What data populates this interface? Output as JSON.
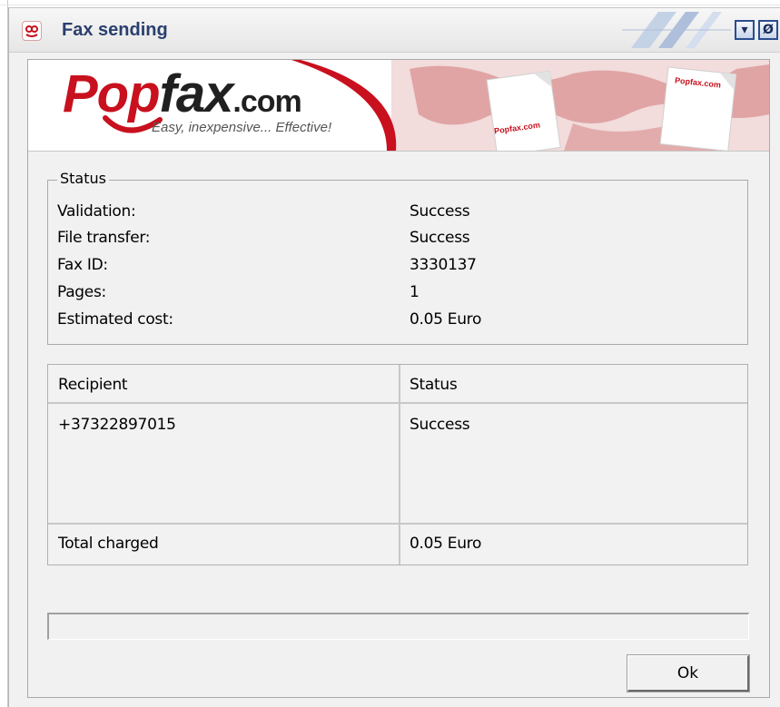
{
  "window": {
    "title": "Fax sending",
    "minimize_glyph": "▾",
    "close_glyph": "Ø"
  },
  "banner": {
    "logo_pop": "Pop",
    "logo_fax": "fax",
    "logo_dotcom": ".com",
    "tagline": "Easy, inexpensive... Effective!",
    "mini_logo": "Popfax.com",
    "brand_color": "#c8101e"
  },
  "status": {
    "legend": "Status",
    "rows": [
      {
        "label": "Validation:",
        "value": "Success"
      },
      {
        "label": "File transfer:",
        "value": "Success"
      },
      {
        "label": "Fax ID:",
        "value": "3330137"
      },
      {
        "label": "Pages:",
        "value": "1"
      },
      {
        "label": "Estimated cost:",
        "value": "0.05 Euro"
      }
    ]
  },
  "recipients": {
    "headers": [
      "Recipient",
      "Status"
    ],
    "rows": [
      {
        "recipient": "+37322897015",
        "status": "Success"
      }
    ],
    "total_label": "Total charged",
    "total_value": "0.05 Euro"
  },
  "progress": {
    "value": 0
  },
  "buttons": {
    "ok": "Ok"
  }
}
